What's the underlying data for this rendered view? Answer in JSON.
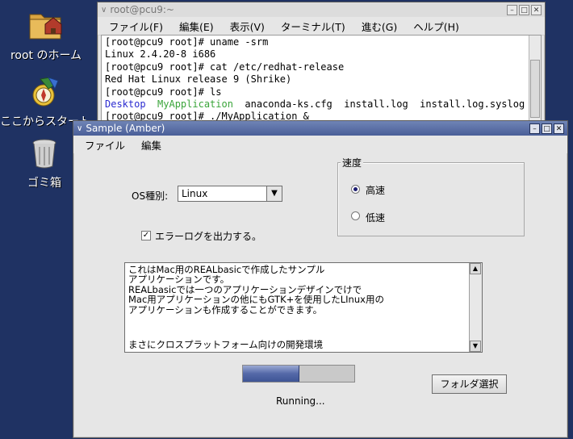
{
  "desktop": {
    "icons": [
      {
        "label": "root のホーム",
        "icon": "home-folder-icon"
      },
      {
        "label": "ここからスタート",
        "icon": "start-here-icon"
      },
      {
        "label": "ゴミ箱",
        "icon": "trash-icon"
      }
    ]
  },
  "terminal": {
    "title": "root@pcu9:~",
    "menu": [
      "ファイル(F)",
      "編集(E)",
      "表示(V)",
      "ターミナル(T)",
      "進む(G)",
      "ヘルプ(H)"
    ],
    "lines": [
      "[root@pcu9 root]# uname -srm",
      "Linux 2.4.20-8 i686",
      "[root@pcu9 root]# cat /etc/redhat-release",
      "Red Hat Linux release 9 (Shrike)",
      "[root@pcu9 root]# ls"
    ],
    "ls_output": {
      "desktop": "Desktop",
      "myapp": "MyApplication",
      "rest": "anaconda-ks.cfg  install.log  install.log.syslog"
    },
    "last_line": "[root@pcu9 root]# ./MyApplication &",
    "colors": {
      "dir": "#2b2bd0",
      "exec": "#3aa53a"
    }
  },
  "sample": {
    "title": "Sample (Amber)",
    "menu": [
      "ファイル",
      "編集"
    ],
    "os_label": "OS種別:",
    "os_value": "Linux",
    "speed_group": "速度",
    "speed_fast": "高速",
    "speed_slow": "低速",
    "speed_selected": "fast",
    "errorlog_label": "エラーログを出力する。",
    "errorlog_checked": true,
    "textarea_lines": [
      "これはMac用のREALbasicで作成したサンプル",
      "アプリケーションです。",
      "REALbasicでは一つのアプリケーションデザインでけで",
      "Mac用アプリケーションの他にもGTK+を使用したLInux用の",
      "アプリケーションも作成することができます。"
    ],
    "textarea_last": "まさにクロスプラットフォーム向けの開発環境",
    "progress_fraction": 0.5,
    "status": "Running...",
    "folder_button": "フォルダ選択"
  }
}
